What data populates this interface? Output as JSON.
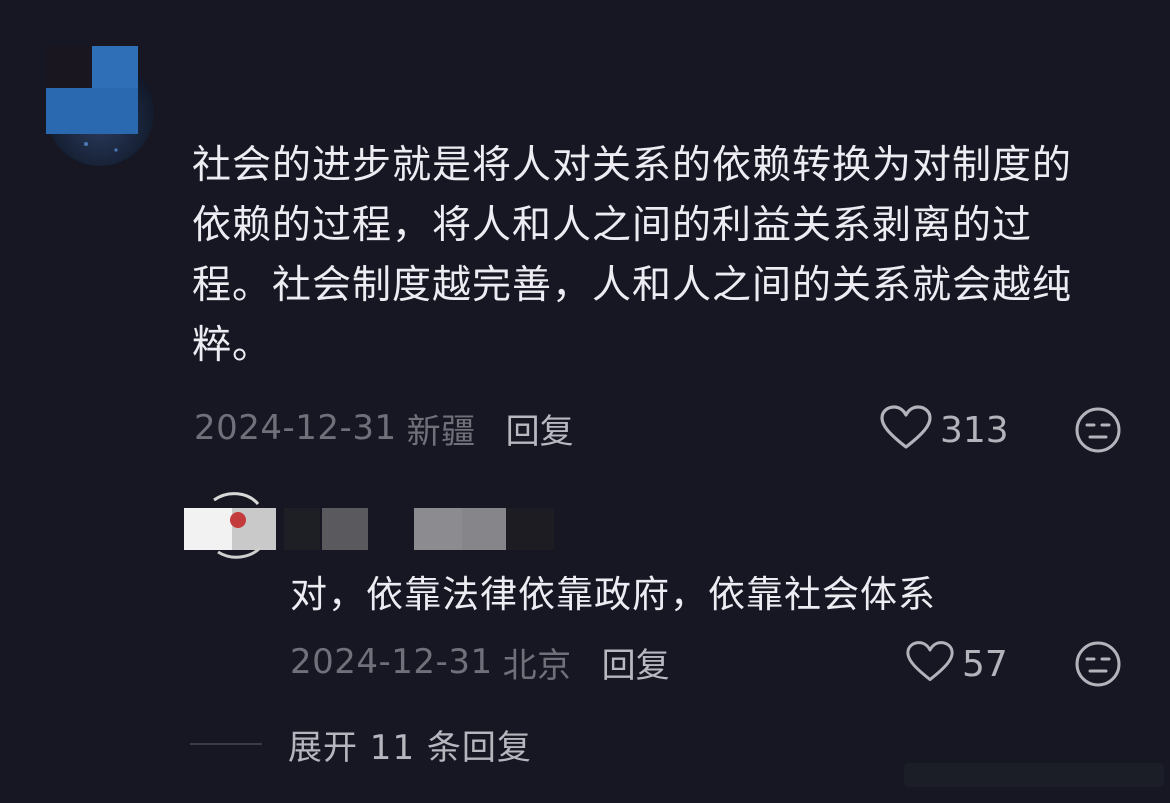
{
  "comment": {
    "text": "社会的进步就是将人对关系的依赖转换为对制度的\n依赖的过程，将人和人之间的利益关系剥离的过\n程。社会制度越完善，人和人之间的关系就会越纯\n粹。",
    "date": "2024-12-31",
    "location": "新疆",
    "reply_label": "回复",
    "likes": "313",
    "icons": {
      "like": "heart-outline-icon",
      "react": "neutral-face-icon"
    }
  },
  "reply": {
    "text": "对，依靠法律依靠政府，依靠社会体系",
    "date": "2024-12-31",
    "location": "北京",
    "reply_label": "回复",
    "likes": "57",
    "icons": {
      "like": "heart-outline-icon",
      "react": "neutral-face-icon"
    }
  },
  "expand": {
    "label": "展开 11 条回复"
  },
  "colors": {
    "background": "#161722",
    "text_primary": "#ececf2",
    "text_secondary": "#6f7079",
    "text_action": "#b7b8c0"
  }
}
